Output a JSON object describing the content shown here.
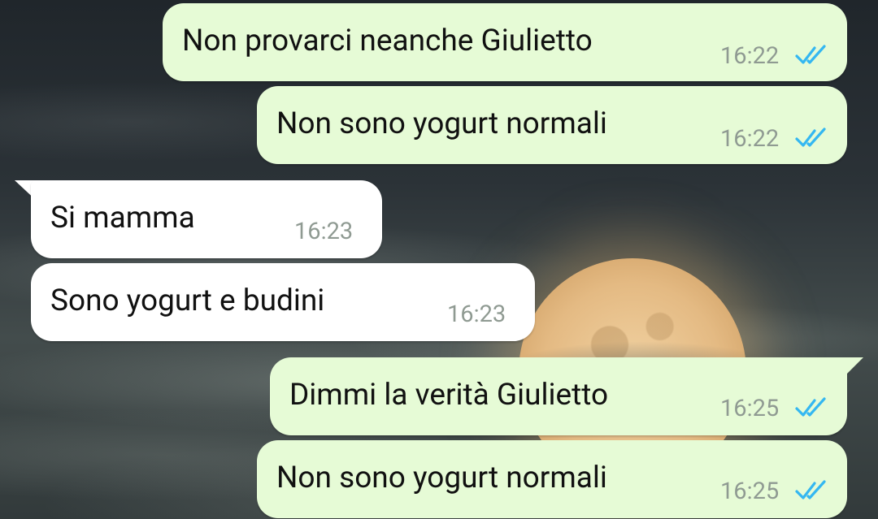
{
  "messages": [
    {
      "text": "Non provarci neanche Giulietto",
      "time": "16:22",
      "direction": "outgoing",
      "status": "read-double-check"
    },
    {
      "text": "Non sono yogurt normali",
      "time": "16:22",
      "direction": "outgoing",
      "status": "read-double-check"
    },
    {
      "text": "Si mamma",
      "time": "16:23",
      "direction": "incoming"
    },
    {
      "text": "Sono yogurt e budini",
      "time": "16:23",
      "direction": "incoming"
    },
    {
      "text": "Dimmi la verità Giulietto",
      "time": "16:25",
      "direction": "outgoing",
      "status": "read-double-check"
    },
    {
      "text": "Non sono yogurt normali",
      "time": "16:25",
      "direction": "outgoing",
      "status": "read-double-check"
    }
  ],
  "colors": {
    "outgoing_bubble": "#e6fbd6",
    "incoming_bubble": "#ffffff",
    "read_check": "#34b7f1",
    "timestamp": "#8f9a92"
  },
  "icons": {
    "read_receipt": "double-check-icon"
  }
}
